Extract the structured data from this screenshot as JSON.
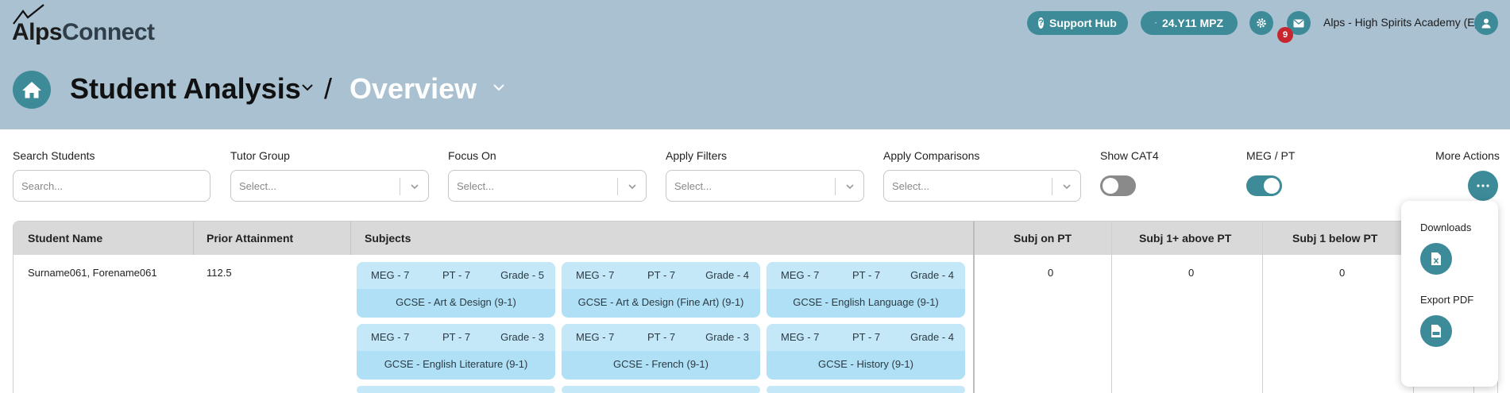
{
  "brand": {
    "part1": "Alps",
    "part2": "Connect"
  },
  "header": {
    "support_hub": "Support Hub",
    "cohort": "24.Y11 MPZ",
    "notifications_count": "9",
    "school_name": "Alps - High Spirits Academy (E)"
  },
  "breadcrumb": {
    "section": "Student Analysis",
    "separator": "/",
    "page": "Overview"
  },
  "filters": {
    "search": {
      "label": "Search Students",
      "placeholder": "Search..."
    },
    "tutor_group": {
      "label": "Tutor Group",
      "placeholder": "Select..."
    },
    "focus_on": {
      "label": "Focus On",
      "placeholder": "Select..."
    },
    "apply_filters": {
      "label": "Apply Filters",
      "placeholder": "Select..."
    },
    "apply_comparisons": {
      "label": "Apply Comparisons",
      "placeholder": "Select..."
    },
    "show_cat4": {
      "label": "Show CAT4",
      "on": false
    },
    "meg_pt": {
      "label": "MEG / PT",
      "on": true
    },
    "more_actions": {
      "label": "More Actions"
    }
  },
  "table": {
    "headers": {
      "student_name": "Student Name",
      "prior_attainment": "Prior Attainment",
      "subjects": "Subjects",
      "subj_on_pt": "Subj on PT",
      "subj_above_pt": "Subj 1+ above PT",
      "subj_below_pt": "Subj 1 below PT"
    },
    "row": {
      "student_name": "Surname061, Forename061",
      "prior_attainment": "112.5",
      "subj_on_pt": "0",
      "subj_above_pt": "0",
      "subj_below_pt": "0"
    },
    "subjects": [
      {
        "meg": "MEG - 7",
        "pt": "PT - 7",
        "grade": "Grade - 5",
        "name": "GCSE - Art & Design (9-1)"
      },
      {
        "meg": "MEG - 7",
        "pt": "PT - 7",
        "grade": "Grade - 4",
        "name": "GCSE - Art & Design (Fine Art) (9-1)"
      },
      {
        "meg": "MEG - 7",
        "pt": "PT - 7",
        "grade": "Grade - 4",
        "name": "GCSE - English Language (9-1)"
      },
      {
        "meg": "MEG - 7",
        "pt": "PT - 7",
        "grade": "Grade - 3",
        "name": "GCSE - English Literature (9-1)"
      },
      {
        "meg": "MEG - 7",
        "pt": "PT - 7",
        "grade": "Grade - 3",
        "name": "GCSE - French (9-1)"
      },
      {
        "meg": "MEG - 7",
        "pt": "PT - 7",
        "grade": "Grade - 4",
        "name": "GCSE - History (9-1)"
      }
    ]
  },
  "more_actions_menu": {
    "downloads": "Downloads",
    "export_pdf": "Export PDF"
  },
  "colors": {
    "header_bg": "#a9c1d1",
    "accent": "#3d8a98",
    "badge": "#c8262e",
    "card": "#afe0f5"
  }
}
